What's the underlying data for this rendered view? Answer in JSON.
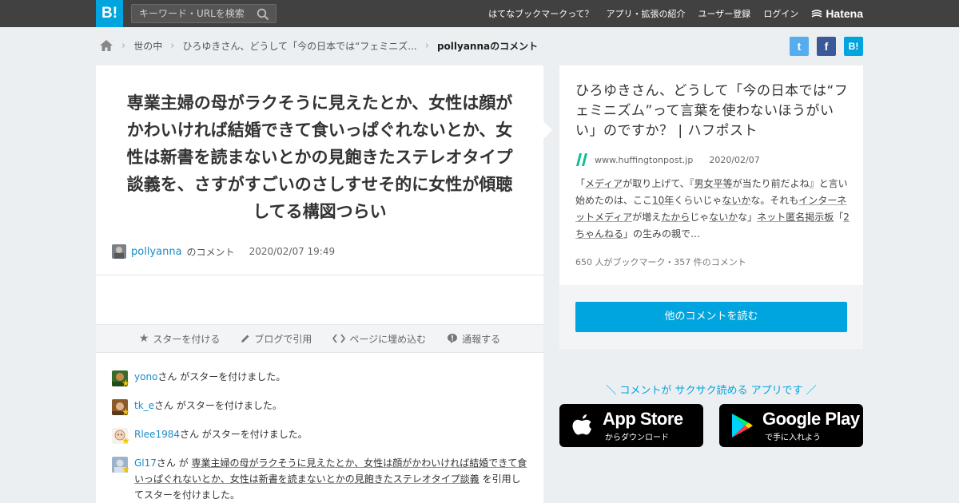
{
  "header": {
    "logo": "B!",
    "search_placeholder": "キーワード・URLを検索",
    "nav": [
      "はてなブックマークって？",
      "アプリ・拡張の紹介",
      "ユーザー登録",
      "ログイン"
    ],
    "hatena": "Hatena"
  },
  "breadcrumb": {
    "items": [
      "世の中",
      "ひろゆきさん、どうして「今の日本では“フェミニズ..."
    ],
    "current": "pollyannaのコメント"
  },
  "share": {
    "twitter": "t",
    "facebook": "f",
    "hatena": "B!"
  },
  "comment": {
    "text": "専業主婦の母がラクそうに見えたとか、女性は顔がかわいければ結婚できて食いっぱぐれないとか、女性は新書を読まないとかの見飽きたステレオタイプ談義を、さすがすごいのさしすせそ的に女性が傾聴してる構図つらい",
    "user": "pollyanna",
    "user_suffix": "のコメント",
    "datetime": "2020/02/07 19:49"
  },
  "actions": [
    "スターを付ける",
    "ブログで引用",
    "ページに埋め込む",
    "通報する"
  ],
  "stars": [
    {
      "user": "yono",
      "text": "さん がスターを付けました。"
    },
    {
      "user": "tk_e",
      "text": "さん がスターを付けました。"
    },
    {
      "user": "Rlee1984",
      "text": "さん がスターを付けました。"
    },
    {
      "user": "Gl17",
      "pre": "さん が ",
      "quote": "専業主婦の母がラクそうに見えたとか、女性は顔がかわいければ結婚できて食いっぱぐれないとか、女性は新書を読まないとかの見飽きたステレオタイプ談義",
      "post": " を引用してスターを付けました。"
    }
  ],
  "entry": {
    "title": "ひろゆきさん、どうして「今の日本では“フェミニズム”って言葉を使わないほうがいい」のですか？ | ハフポスト",
    "site": "www.huffingtonpost.jp",
    "date": "2020/02/07",
    "summary": {
      "s1": "「",
      "k1": "メディア",
      "s2": "が取り上げて、『",
      "k2": "男女平等",
      "s3": "が当たり前だよね』と言い始めたのは、ここ",
      "k3": "10年",
      "s4": "くらいじゃ",
      "k4": "ないか",
      "s5": "な。それも",
      "k5": "インターネットメディア",
      "s6": "が増え",
      "k6": "たから",
      "s7": "じゃ",
      "k7": "ないか",
      "s8": "な」",
      "k8": "ネット匿名掲示板",
      "s9": "「",
      "k9": "2ちゃんねる",
      "s10": "」の生みの親で…"
    },
    "counts": "650 人がブックマーク・357 件のコメント",
    "read_button": "他のコメントを読む"
  },
  "app": {
    "tagline": "＼ コメントが サクサク読める アプリです ／",
    "appstore_big": "App Store",
    "appstore_small": "からダウンロード",
    "googleplay_big": "Google Play",
    "googleplay_small": "で手に入れよう"
  },
  "colors": {
    "accent": "#00a4de",
    "topbar": "#414141",
    "link": "#1c8ac7",
    "star": "#f6c400"
  }
}
